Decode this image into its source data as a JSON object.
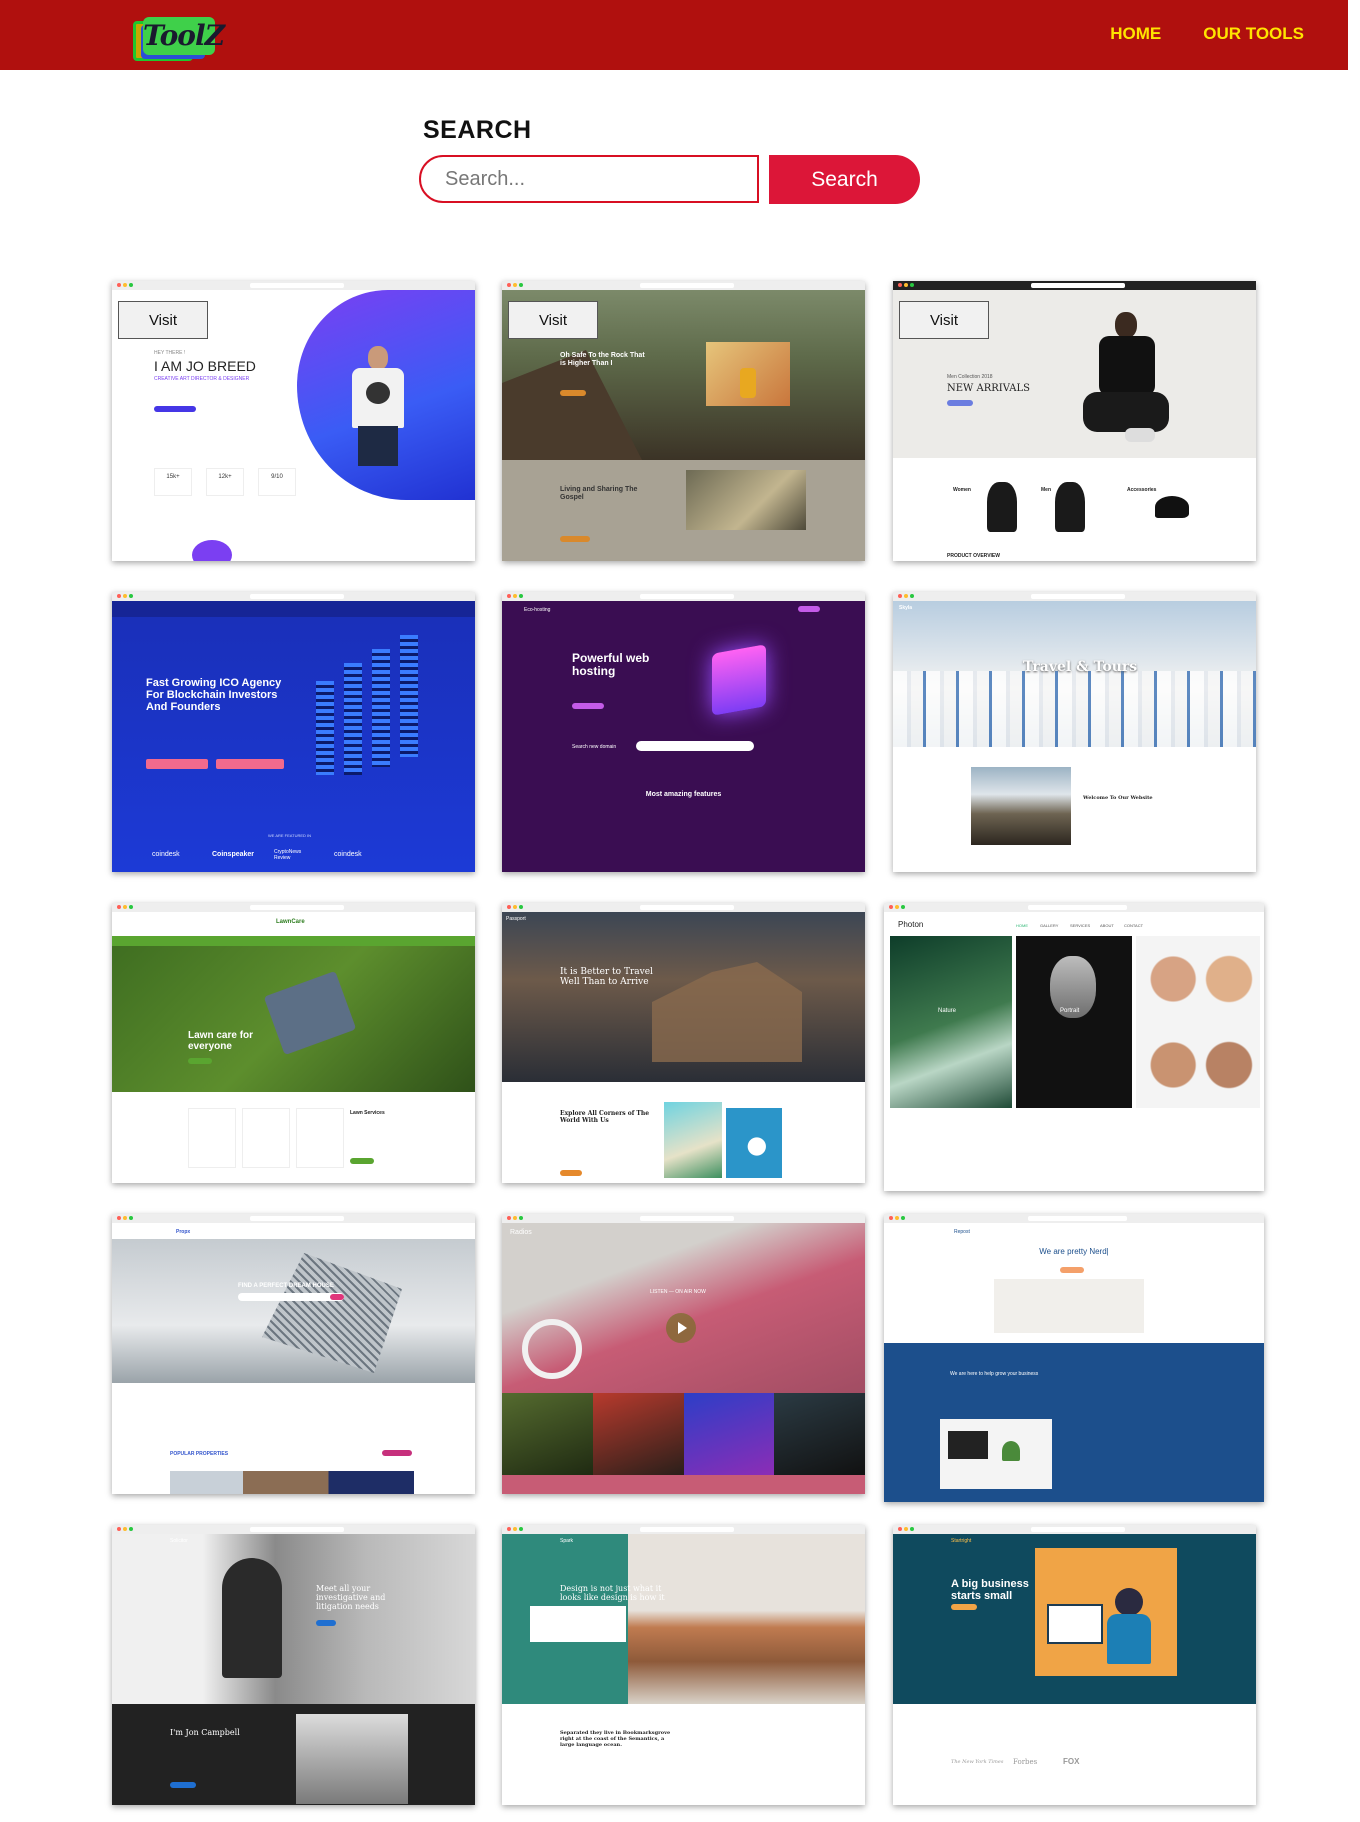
{
  "header": {
    "logo_text": "ToolZ",
    "nav": [
      "HOME",
      "OUR TOOLS"
    ]
  },
  "search": {
    "title": "SEARCH",
    "placeholder": "Search...",
    "button_label": "Search"
  },
  "cards": {
    "visit_label": "Visit",
    "c1": {
      "kicker": "HEY THERE !",
      "headline": "I AM JO BREED",
      "subline": "CREATIVE ART DIRECTOR & DESIGNER",
      "stats": [
        "15k+",
        "12k+",
        "9/10"
      ]
    },
    "c2": {
      "hero": "Oh Safe To the Rock That is Higher Than I",
      "section": "Living and Sharing The Gospel"
    },
    "c3": {
      "collection": "Men Collection 2018",
      "headline": "NEW ARRIVALS",
      "cats": [
        "Women",
        "Men",
        "Accessories"
      ],
      "overview": "PRODUCT OVERVIEW"
    },
    "c4": {
      "headline": "Fast Growing ICO Agency For Blockchain Investors And Founders",
      "featured": "WE ARE FEATURED IN",
      "logos": [
        "coindesk",
        "Coinspeaker",
        "CryptoNews Review",
        "coindesk"
      ]
    },
    "c5": {
      "brand": "Eco-hosting",
      "headline": "Powerful web hosting",
      "domain": "Search new domain",
      "features": "Most amazing features"
    },
    "c6": {
      "brand": "Skyla",
      "headline": "Travel & Tours",
      "welcome": "Welcome To Our Website"
    },
    "c7": {
      "brand": "LawnCare",
      "headline": "Lawn care for everyone",
      "services": "Lawn Services"
    },
    "c8": {
      "brand": "Passport",
      "headline": "It is Better to Travel Well Than to Arrive",
      "section": "Explore All Corners of The World With Us"
    },
    "c9": {
      "brand": "Photon",
      "nav": [
        "HOME",
        "GALLERY",
        "SERVICES",
        "ABOUT",
        "CONTACT"
      ],
      "labels": [
        "Nature",
        "Portrait"
      ]
    },
    "c10": {
      "brand": "Propx",
      "headline": "FIND A PERFECT DREAM HOUSE",
      "popular": "POPULAR PROPERTIES"
    },
    "c11": {
      "brand": "Radios",
      "listen": "LISTEN — ON AIR NOW"
    },
    "c12": {
      "brand": "Repost",
      "headline": "We are pretty Nerd|",
      "sub": "We are here to help grow your business"
    },
    "c13": {
      "brand": "Solicitor",
      "headline": "Meet all your investigative and litigation needs",
      "name": "I'm Jon Campbell"
    },
    "c14": {
      "brand": "Spark",
      "headline": "Design is not just what it looks like design is how it",
      "quote": "Separated they live in Bookmarksgrove right at the coast of the Semantics, a large language ocean."
    },
    "c15": {
      "brand": "Startright",
      "headline": "A big business starts small",
      "press": [
        "The New York Times",
        "Forbes",
        "FOX"
      ]
    }
  }
}
